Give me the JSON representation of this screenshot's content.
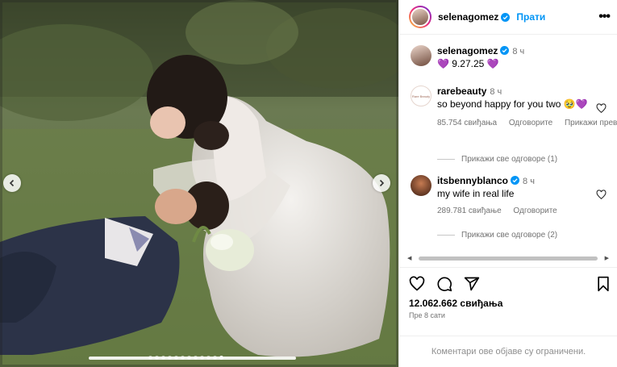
{
  "post": {
    "author": "selenagomez",
    "follow_label": "Прати",
    "more_icon": "more-options-icon",
    "caption": {
      "author": "selenagomez",
      "time": "8 ч",
      "text": "💜 9.27.25 💜"
    },
    "comments": [
      {
        "author": "rarebeauty",
        "time": "8 ч",
        "text": "so beyond happy for you two 🥹💜",
        "likes": "85.754 свиђања",
        "reply": "Одговорите",
        "translate": "Прикажи прев",
        "replies": "Прикажи све одговоре (1)"
      },
      {
        "author": "itsbennyblanco",
        "time": "8 ч",
        "text": "my wife in real life",
        "likes": "289.781 свиђање",
        "reply": "Одговорите",
        "replies": "Прикажи све одговоре (2)"
      }
    ],
    "likes_total": "12.062.662 свиђања",
    "posted_ago": "Пре 8 сати",
    "comments_limited": "Коментари ове објаве су ограничени.",
    "carousel": {
      "count": 12,
      "active_index": 11
    },
    "colors": {
      "accent": "#0095f6",
      "muted": "#737373",
      "verified": "#0095f6"
    }
  }
}
